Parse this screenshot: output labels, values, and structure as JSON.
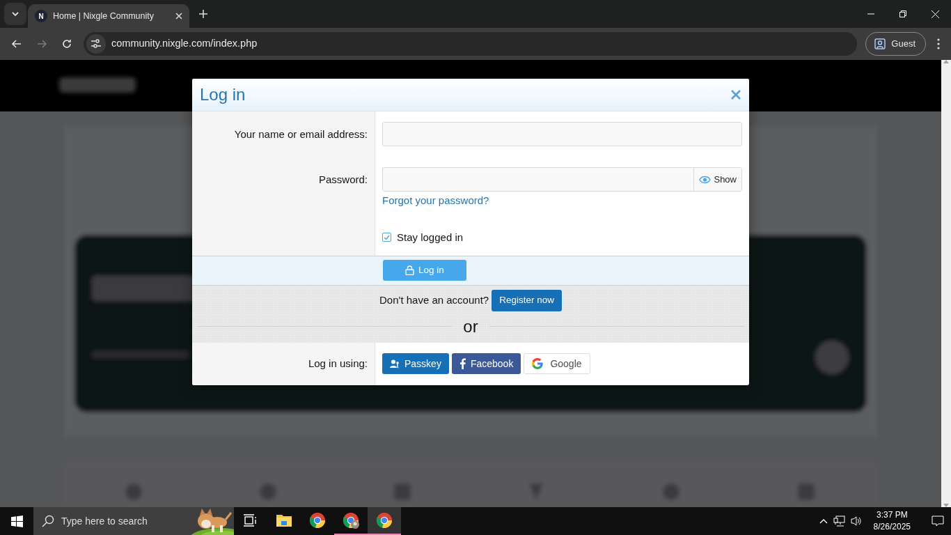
{
  "browser": {
    "tab": {
      "favicon": "N",
      "title": "Home | Nixgle Community"
    },
    "nav": [
      {
        "kind": "back",
        "disabled": false
      },
      {
        "kind": "forward",
        "disabled": true
      },
      {
        "kind": "reload",
        "disabled": false
      }
    ],
    "address": "community.nixgle.com/index.php",
    "profile": "Guest"
  },
  "modal": {
    "title": "Log in",
    "fields": [
      {
        "kind": "text",
        "label": "Your name or email address:"
      },
      {
        "kind": "password",
        "label": "Password:",
        "toggle": "Show",
        "link": "Forgot your password?"
      }
    ],
    "remember": {
      "label": "Stay logged in",
      "checked": true
    },
    "submit": "Log in",
    "register": {
      "prompt": "Don't have an account?",
      "button": "Register now"
    },
    "divider": "or",
    "providers": {
      "label": "Log in using:",
      "items": [
        {
          "kind": "passkey",
          "label": "Passkey"
        },
        {
          "kind": "facebook",
          "label": "Facebook"
        },
        {
          "kind": "google",
          "label": "Google"
        }
      ]
    }
  },
  "taskbar": {
    "search_placeholder": "Type here to search",
    "apps": [
      {
        "kind": "task-view",
        "running": false,
        "selected": false
      },
      {
        "kind": "explorer",
        "running": false,
        "selected": false
      },
      {
        "kind": "chrome",
        "running": false,
        "selected": false
      },
      {
        "kind": "chrome-profile",
        "running": true,
        "selected": false
      },
      {
        "kind": "chrome",
        "running": true,
        "selected": true
      }
    ],
    "time": "3:37 PM",
    "date": "8/26/2025"
  }
}
